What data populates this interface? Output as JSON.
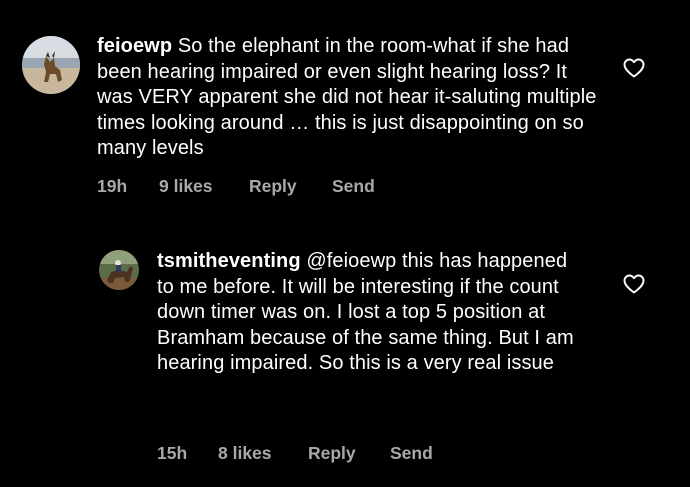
{
  "comments": [
    {
      "username": "feioewp",
      "text": "So the elephant in the room-what if she had been hearing impaired or even slight hearing loss? It was VERY apparent she did not hear it-saluting multiple times looking around … this is just disappointing on so many levels",
      "time": "19h",
      "likes": "9 likes",
      "reply_label": "Reply",
      "send_label": "Send"
    },
    {
      "username": "tsmitheventing",
      "text": "@feioewp this has happened to me before. It will be interesting if the count down timer was on. I lost a top 5 position at Bramham because of the same thing. But I am hearing impaired. So this is a very real issue",
      "time": "15h",
      "likes": "8 likes",
      "reply_label": "Reply",
      "send_label": "Send"
    }
  ],
  "colors": {
    "background": "#000000",
    "text": "#ffffff",
    "meta": "#a8a8a8"
  },
  "icons": {
    "like": "heart-outline-icon"
  }
}
